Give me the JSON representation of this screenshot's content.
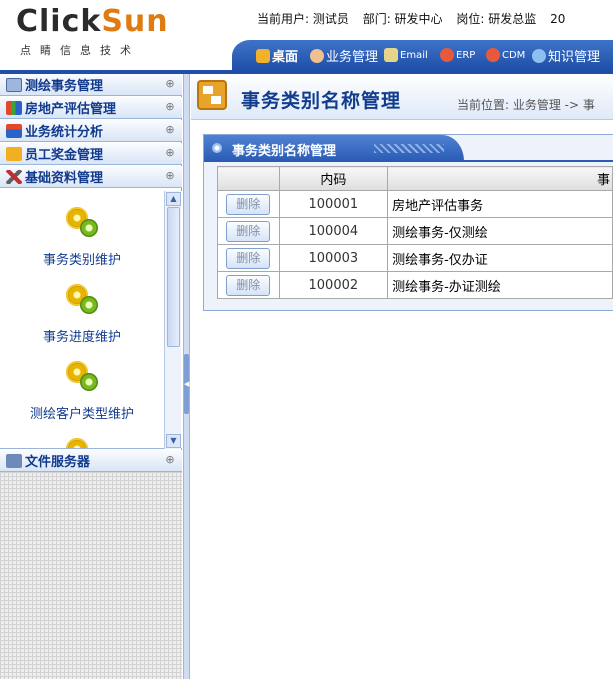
{
  "header": {
    "logo_part1": "Click",
    "logo_part2": "Sun",
    "logo_sub": "点睛信息技术",
    "user": "当前用户: 测试员",
    "dept": "部门: 研发中心",
    "post": "岗位: 研发总监",
    "date_fragment": "20"
  },
  "nav": {
    "items": [
      {
        "label": "桌面"
      },
      {
        "label": "业务管理"
      },
      {
        "label": "Email"
      },
      {
        "label": "ERP"
      },
      {
        "label": "CDM"
      },
      {
        "label": "知识管理"
      }
    ]
  },
  "sidebar": {
    "items": [
      {
        "label": "测绘事务管理"
      },
      {
        "label": "房地产评估管理"
      },
      {
        "label": "业务统计分析"
      },
      {
        "label": "员工奖金管理"
      },
      {
        "label": "基础资料管理"
      }
    ],
    "toggle_symbol": "⊕",
    "sub_entries": [
      {
        "label": "事务类别维护"
      },
      {
        "label": "事务进度维护"
      },
      {
        "label": "测绘客户类型维护"
      }
    ],
    "bottom_item": {
      "label": "文件服务器"
    }
  },
  "main": {
    "title": "事务类别名称管理",
    "location": "当前位置: 业务管理 -> 事",
    "panel_title": "事务类别名称管理",
    "columns": [
      "",
      "内码",
      "事"
    ],
    "rows": [
      {
        "action": "删除",
        "code": "100001",
        "name": "房地产评估事务"
      },
      {
        "action": "删除",
        "code": "100004",
        "name": "测绘事务-仅测绘"
      },
      {
        "action": "删除",
        "code": "100003",
        "name": "测绘事务-仅办证"
      },
      {
        "action": "删除",
        "code": "100002",
        "name": "测绘事务-办证测绘"
      }
    ]
  },
  "colors": {
    "brand_blue": "#1f4fa8",
    "logo_orange": "#e07b12",
    "menu_text": "#113a8c"
  }
}
